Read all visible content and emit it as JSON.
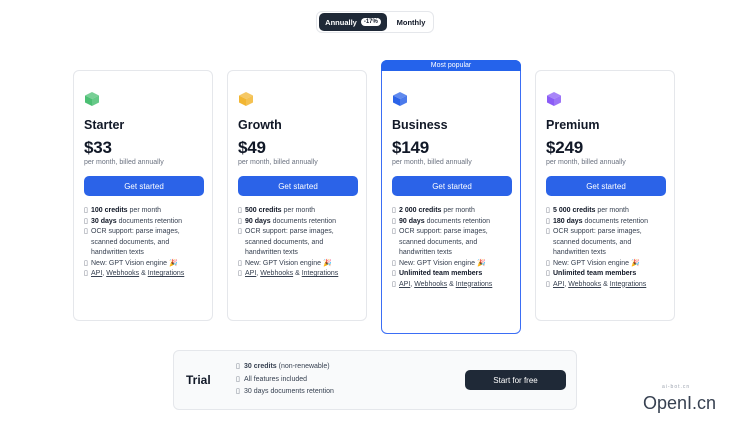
{
  "billing_toggle": {
    "annual_label": "Annually",
    "annual_discount": "-17%",
    "monthly_label": "Monthly"
  },
  "popular_banner": "Most popular",
  "cta_label": "Get started",
  "plans": [
    {
      "name": "Starter",
      "price": "$33",
      "billing": "per month, billed annually",
      "icon": "green-cube-icon",
      "icon_color": "#4bbf73",
      "features": [
        {
          "bold": "100 credits",
          "rest": " per month"
        },
        {
          "bold": "30 days",
          "rest": " documents retention"
        },
        {
          "bold": "",
          "rest": "OCR support: parse images, scanned documents, and handwritten texts"
        },
        {
          "bold": "",
          "rest": "New: GPT Vision engine 🎉"
        }
      ],
      "team_members": "",
      "links": {
        "api": "API",
        "webhooks": "Webhooks",
        "and": " & ",
        "integrations": "Integrations"
      }
    },
    {
      "name": "Growth",
      "price": "$49",
      "billing": "per month, billed annually",
      "icon": "yellow-cube-icon",
      "icon_color": "#f2b632",
      "features": [
        {
          "bold": "500 credits",
          "rest": " per month"
        },
        {
          "bold": "90 days",
          "rest": " documents retention"
        },
        {
          "bold": "",
          "rest": "OCR support: parse images, scanned documents, and handwritten texts"
        },
        {
          "bold": "",
          "rest": "New: GPT Vision engine 🎉"
        }
      ],
      "team_members": "",
      "links": {
        "api": "API",
        "webhooks": "Webhooks",
        "and": " & ",
        "integrations": "Integrations"
      }
    },
    {
      "name": "Business",
      "price": "$149",
      "billing": "per month, billed annually",
      "icon": "blue-cube-icon",
      "icon_color": "#2b63e8",
      "features": [
        {
          "bold": "2 000 credits",
          "rest": " per month"
        },
        {
          "bold": "90 days",
          "rest": " documents retention"
        },
        {
          "bold": "",
          "rest": "OCR support: parse images, scanned documents, and handwritten texts"
        },
        {
          "bold": "",
          "rest": "New: GPT Vision engine 🎉"
        }
      ],
      "team_members": "Unlimited team members",
      "links": {
        "api": "API",
        "webhooks": "Webhooks",
        "and": " & ",
        "integrations": "Integrations"
      }
    },
    {
      "name": "Premium",
      "price": "$249",
      "billing": "per month, billed annually",
      "icon": "purple-cube-icon",
      "icon_color": "#8b5cf6",
      "features": [
        {
          "bold": "5 000 credits",
          "rest": " per month"
        },
        {
          "bold": "180 days",
          "rest": " documents retention"
        },
        {
          "bold": "",
          "rest": "OCR support: parse images, scanned documents, and handwritten texts"
        },
        {
          "bold": "",
          "rest": "New: GPT Vision engine 🎉"
        }
      ],
      "team_members": "Unlimited team members",
      "links": {
        "api": "API",
        "webhooks": "Webhooks",
        "and": " & ",
        "integrations": "Integrations"
      }
    }
  ],
  "trial": {
    "title": "Trial",
    "features": [
      {
        "bold": "30 credits",
        "rest": " (non-renewable)"
      },
      {
        "bold": "",
        "rest": "All features included"
      },
      {
        "bold": "",
        "rest": "30 days documents retention"
      }
    ],
    "button": "Start for free"
  },
  "watermark": {
    "main": "OpenI.cn",
    "small": "ai-bot.cn"
  }
}
